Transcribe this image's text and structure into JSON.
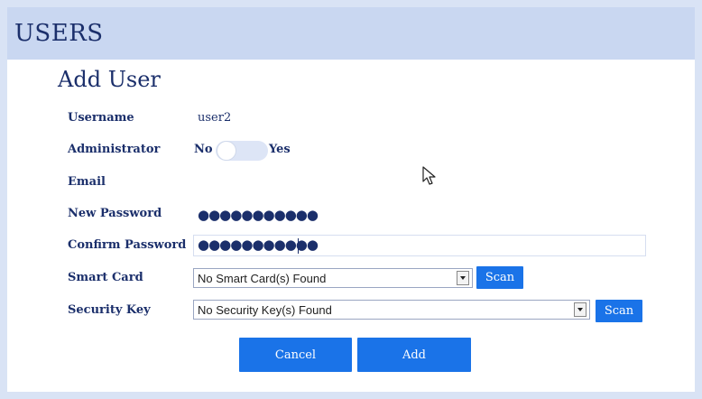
{
  "header": {
    "title": "USERS"
  },
  "form": {
    "title": "Add User",
    "username": {
      "label": "Username",
      "value": "user2"
    },
    "administrator": {
      "label": "Administrator",
      "off_label": "No",
      "on_label": "Yes",
      "enabled": false
    },
    "email": {
      "label": "Email",
      "value": ""
    },
    "new_password": {
      "label": "New Password",
      "masked_value": "●●●●●●●●●●●"
    },
    "confirm_password": {
      "label": "Confirm Password",
      "masked_value": "●●●●●●●●●●●"
    },
    "smart_card": {
      "label": "Smart Card",
      "selected": "No Smart Card(s) Found",
      "scan_label": "Scan"
    },
    "security_key": {
      "label": "Security Key",
      "selected": "No Security Key(s) Found",
      "scan_label": "Scan"
    },
    "cancel_label": "Cancel",
    "add_label": "Add"
  },
  "colors": {
    "accent": "#1a73e8",
    "text": "#1b2f6b",
    "header_bg": "#c9d7f1"
  }
}
